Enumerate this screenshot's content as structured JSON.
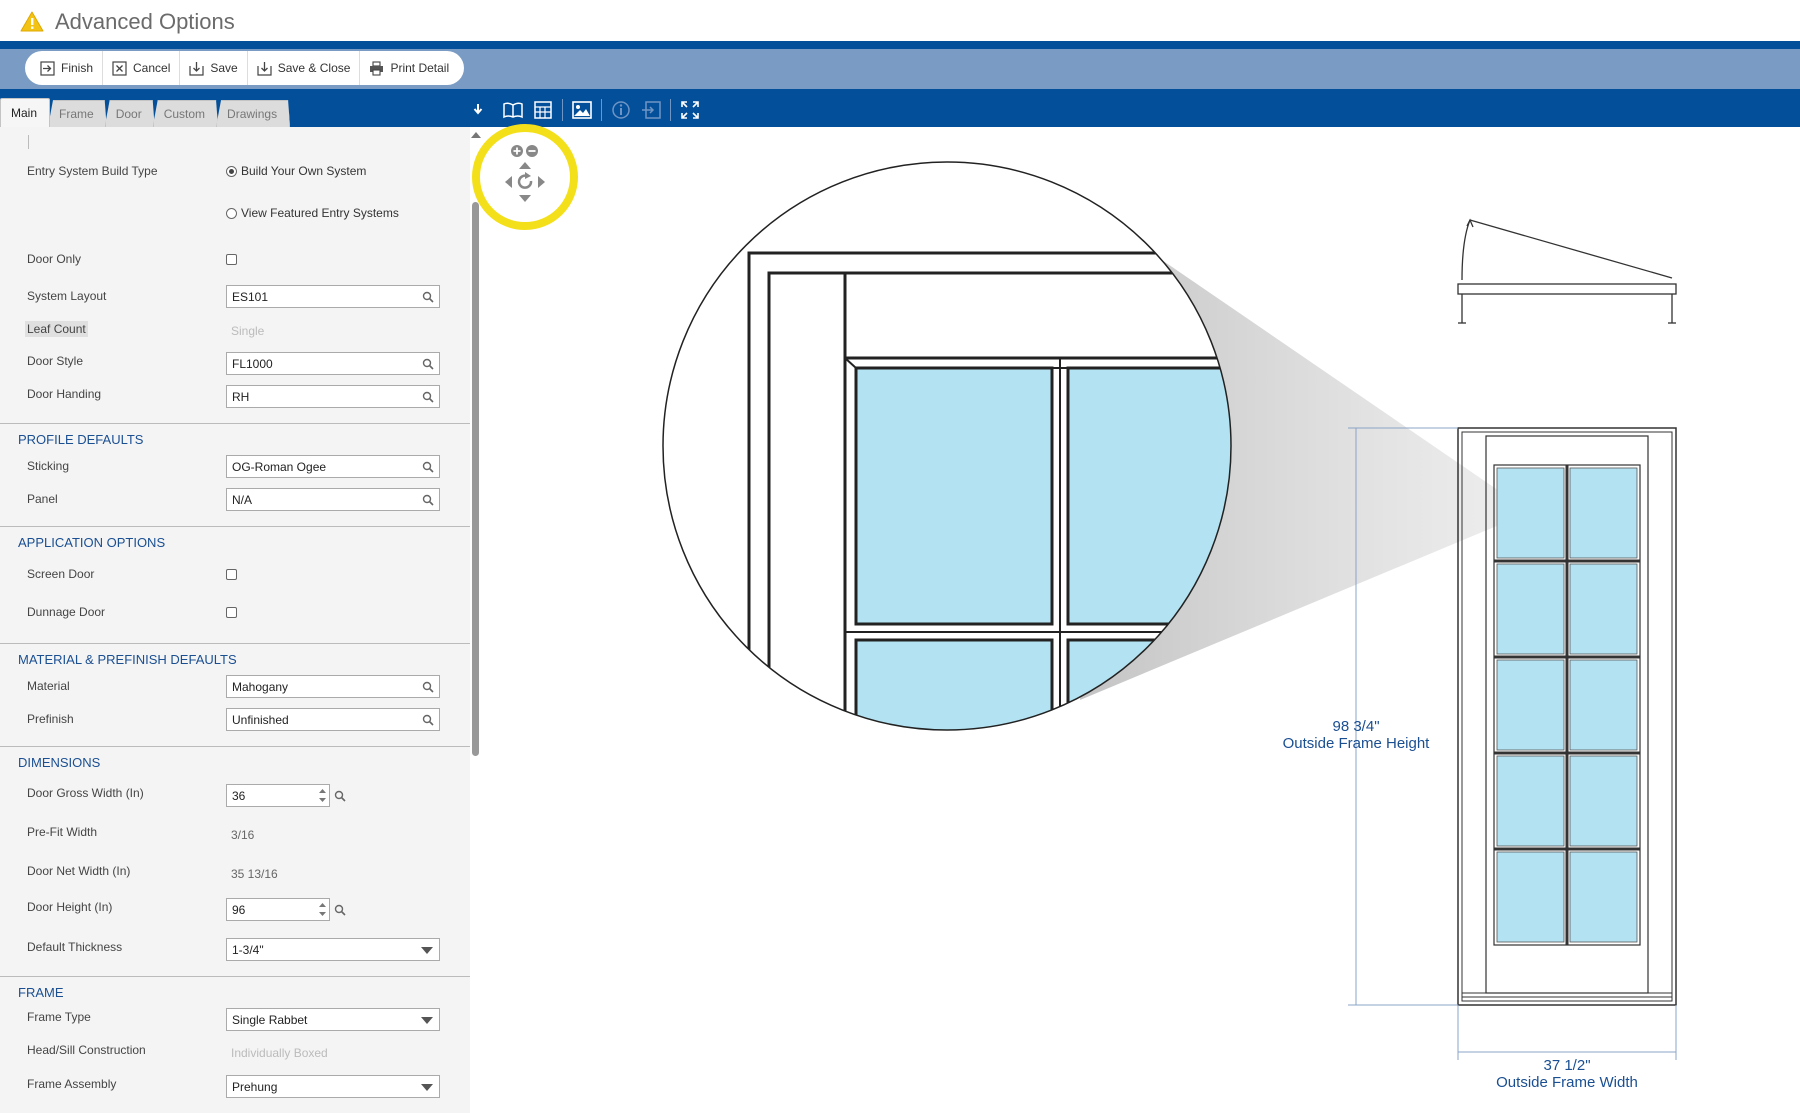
{
  "window": {
    "title": "Advanced Options"
  },
  "toolbar": {
    "finish": "Finish",
    "cancel": "Cancel",
    "save": "Save",
    "save_close": "Save & Close",
    "print_detail": "Print Detail"
  },
  "tabs": [
    {
      "label": "Main",
      "active": true
    },
    {
      "label": "Frame"
    },
    {
      "label": "Door"
    },
    {
      "label": "Custom"
    },
    {
      "label": "Drawings"
    }
  ],
  "form": {
    "entry_system_build_type": {
      "label": "Entry System Build Type",
      "options": [
        "Build Your Own System",
        "View Featured Entry Systems"
      ],
      "selected": "Build Your Own System"
    },
    "door_only": {
      "label": "Door Only",
      "checked": false
    },
    "system_layout": {
      "label": "System Layout",
      "value": "ES101"
    },
    "leaf_count": {
      "label": "Leaf Count",
      "value": "Single"
    },
    "door_style": {
      "label": "Door Style",
      "value": "FL1000"
    },
    "door_handing": {
      "label": "Door Handing",
      "value": "RH"
    },
    "profile_defaults": {
      "title": "PROFILE DEFAULTS",
      "sticking": {
        "label": "Sticking",
        "value": "OG-Roman Ogee"
      },
      "panel": {
        "label": "Panel",
        "value": "N/A"
      }
    },
    "application_options": {
      "title": "APPLICATION OPTIONS",
      "screen_door": {
        "label": "Screen Door",
        "checked": false
      },
      "dunnage_door": {
        "label": "Dunnage Door",
        "checked": false
      }
    },
    "material_defaults": {
      "title": "MATERIAL & PREFINISH DEFAULTS",
      "material": {
        "label": "Material",
        "value": "Mahogany"
      },
      "prefinish": {
        "label": "Prefinish",
        "value": "Unfinished"
      }
    },
    "dimensions": {
      "title": "DIMENSIONS",
      "door_gross_width": {
        "label": "Door Gross Width (In)",
        "value": "36"
      },
      "pre_fit_width": {
        "label": "Pre-Fit Width",
        "value": "3/16"
      },
      "door_net_width": {
        "label": "Door Net Width (In)",
        "value": "35 13/16"
      },
      "door_height": {
        "label": "Door Height (In)",
        "value": "96"
      },
      "default_thickness": {
        "label": "Default Thickness",
        "value": "1-3/4\""
      }
    },
    "frame": {
      "title": "FRAME",
      "frame_type": {
        "label": "Frame Type",
        "value": "Single Rabbet"
      },
      "head_sill_construction": {
        "label": "Head/Sill Construction",
        "value": "Individually Boxed"
      },
      "frame_assembly": {
        "label": "Frame Assembly",
        "value": "Prehung"
      }
    }
  },
  "drawing": {
    "height_dim": "98 3/4\"",
    "height_label": "Outside Frame Height",
    "width_dim": "37 1/2\"",
    "width_label": "Outside Frame Width",
    "glass_color": "#b3e3f2",
    "accent_color": "#044f9a",
    "nav_ring_color": "#f3e01b"
  }
}
